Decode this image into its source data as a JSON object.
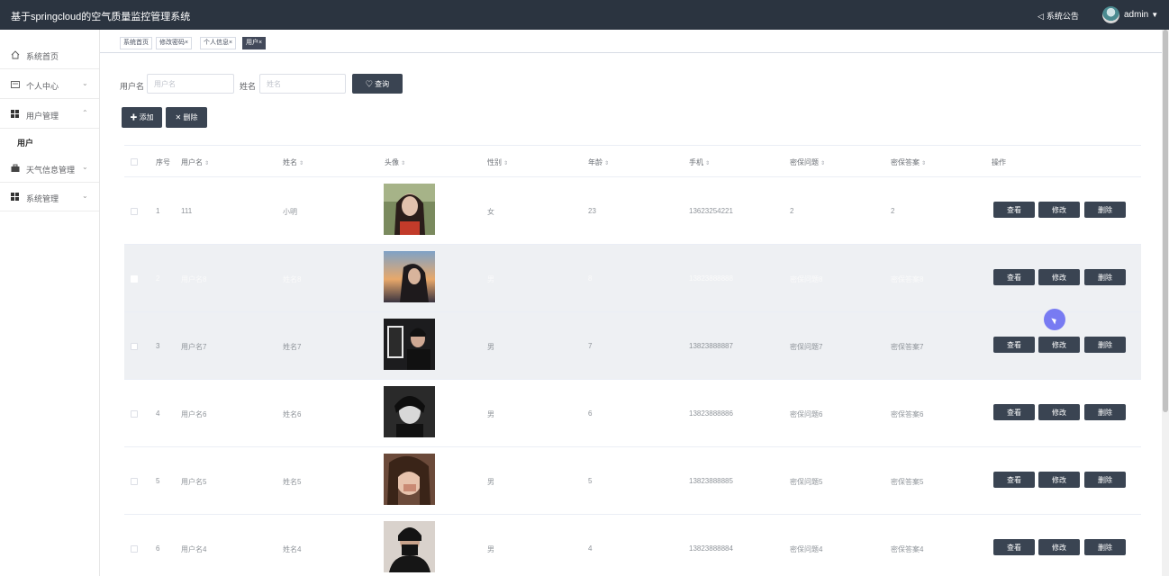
{
  "app": {
    "title": "基于springcloud的空气质量监控管理系统",
    "notice_label": "系统公告",
    "username": "admin"
  },
  "sidebar": {
    "items": [
      {
        "label": "系统首页",
        "icon": "home-icon"
      },
      {
        "label": "个人中心",
        "icon": "id-card-icon"
      },
      {
        "label": "用户管理",
        "icon": "grid-icon"
      },
      {
        "label": "天气信息管理",
        "icon": "briefcase-icon"
      },
      {
        "label": "系统管理",
        "icon": "grid-icon"
      }
    ],
    "subitem": "用户"
  },
  "tags": [
    {
      "label": "系统首页"
    },
    {
      "label": "修改密码×"
    },
    {
      "label": "个人信息×"
    },
    {
      "label": "用户×"
    }
  ],
  "search": {
    "username_label": "用户名",
    "username_placeholder": "用户名",
    "name_label": "姓名",
    "name_placeholder": "姓名",
    "query_button": "查询"
  },
  "actions": {
    "add_button": "添加",
    "delete_button": "删除"
  },
  "table": {
    "headers": [
      "序号",
      "用户名",
      "姓名",
      "头像",
      "性别",
      "年龄",
      "手机",
      "密保问题",
      "密保答案",
      "操作"
    ],
    "op_labels": [
      "查看",
      "修改",
      "删除"
    ],
    "rows": [
      {
        "index": "1",
        "username": "111",
        "name": "小明",
        "gender": "女",
        "age": "23",
        "phone": "13623254221",
        "question": "2",
        "answer": "2"
      },
      {
        "index": "2",
        "username": "用户名8",
        "name": "姓名8",
        "gender": "男",
        "age": "8",
        "phone": "13823888888",
        "question": "密保问题8",
        "answer": "密保答案8"
      },
      {
        "index": "3",
        "username": "用户名7",
        "name": "姓名7",
        "gender": "男",
        "age": "7",
        "phone": "13823888887",
        "question": "密保问题7",
        "answer": "密保答案7"
      },
      {
        "index": "4",
        "username": "用户名6",
        "name": "姓名6",
        "gender": "男",
        "age": "6",
        "phone": "13823888886",
        "question": "密保问题6",
        "answer": "密保答案6"
      },
      {
        "index": "5",
        "username": "用户名5",
        "name": "姓名5",
        "gender": "男",
        "age": "5",
        "phone": "13823888885",
        "question": "密保问题5",
        "answer": "密保答案5"
      },
      {
        "index": "6",
        "username": "用户名4",
        "name": "姓名4",
        "gender": "男",
        "age": "4",
        "phone": "13823888884",
        "question": "密保问题4",
        "answer": "密保答案4"
      }
    ]
  },
  "colors": {
    "topbar": "#2b3440",
    "dark_button": "#3a4452",
    "cursor": "#6366f1"
  }
}
